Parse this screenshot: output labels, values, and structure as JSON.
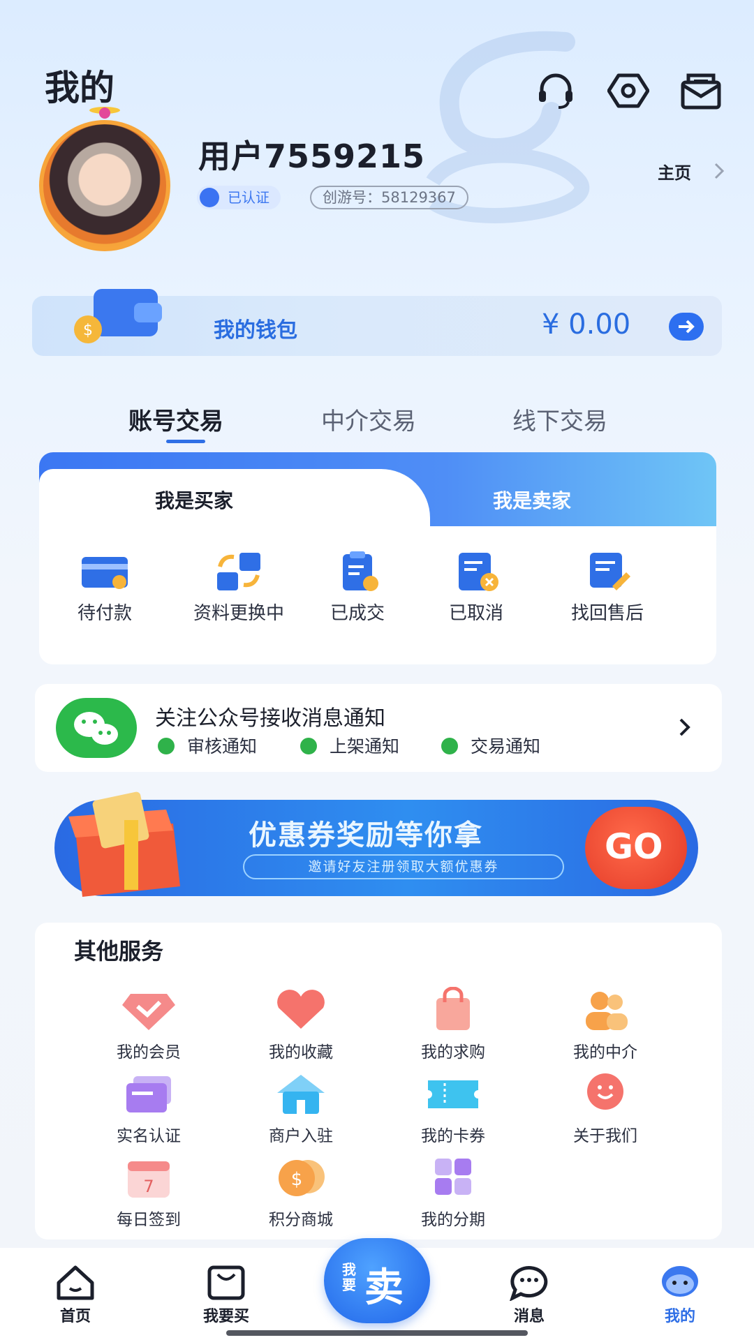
{
  "header": {
    "title": "我的",
    "icons": [
      "headset-icon",
      "settings-hex-icon",
      "mail-icon"
    ],
    "username": "用户7559215",
    "verified_label": "已认证",
    "uid_label": "创游号：58129367",
    "home_link": "主页"
  },
  "wallet": {
    "label": "我的钱包",
    "amount": "¥ 0.00"
  },
  "trade_tabs": [
    {
      "label": "账号交易",
      "active": true
    },
    {
      "label": "中介交易",
      "active": false
    },
    {
      "label": "线下交易",
      "active": false
    }
  ],
  "roles": {
    "buyer": "我是买家",
    "seller": "我是卖家"
  },
  "orders": [
    {
      "label": "待付款",
      "icon": "card-clock-icon"
    },
    {
      "label": "资料更换中",
      "icon": "swap-blocks-icon"
    },
    {
      "label": "已成交",
      "icon": "clipboard-check-icon"
    },
    {
      "label": "已取消",
      "icon": "doc-cancel-icon"
    },
    {
      "label": "找回售后",
      "icon": "doc-edit-icon"
    }
  ],
  "notify": {
    "title": "关注公众号接收消息通知",
    "items": [
      "审核通知",
      "上架通知",
      "交易通知"
    ]
  },
  "banner": {
    "title": "优惠券奖励等你拿",
    "subtitle": "邀请好友注册领取大额优惠券",
    "go": "GO"
  },
  "services": {
    "title": "其他服务",
    "items": [
      {
        "label": "我的会员",
        "icon": "member-icon",
        "color": "#f26a6a"
      },
      {
        "label": "我的收藏",
        "icon": "heart-icon",
        "color": "#f5736c"
      },
      {
        "label": "我的求购",
        "icon": "shopping-bag-icon",
        "color": "#f58a7a"
      },
      {
        "label": "我的中介",
        "icon": "people-icon",
        "color": "#f7a24a"
      },
      {
        "label": "实名认证",
        "icon": "id-card-icon",
        "color": "#a77cf0"
      },
      {
        "label": "商户入驻",
        "icon": "shop-house-icon",
        "color": "#35b4f0"
      },
      {
        "label": "我的卡券",
        "icon": "ticket-icon",
        "color": "#3ec3ef"
      },
      {
        "label": "关于我们",
        "icon": "smile-bubble-icon",
        "color": "#f5736c"
      },
      {
        "label": "每日签到",
        "icon": "calendar-icon",
        "color": "#f58a8a"
      },
      {
        "label": "积分商城",
        "icon": "coin-icon",
        "color": "#f7a24a"
      },
      {
        "label": "我的分期",
        "icon": "grid-icon",
        "color": "#a77cf0"
      }
    ]
  },
  "bottom_nav": {
    "items": [
      {
        "label": "首页",
        "icon": "home-icon"
      },
      {
        "label": "我要买",
        "icon": "bag-icon"
      },
      {
        "label": "消息",
        "icon": "chat-icon"
      },
      {
        "label": "我的",
        "icon": "profile-face-icon"
      }
    ],
    "sell_small": "我要",
    "sell_big": "卖"
  },
  "colors": {
    "accent": "#2f6fe6",
    "wallet_text": "#2a6de0",
    "wechat_green": "#2cb94b",
    "promo_red": "#e33a27"
  }
}
